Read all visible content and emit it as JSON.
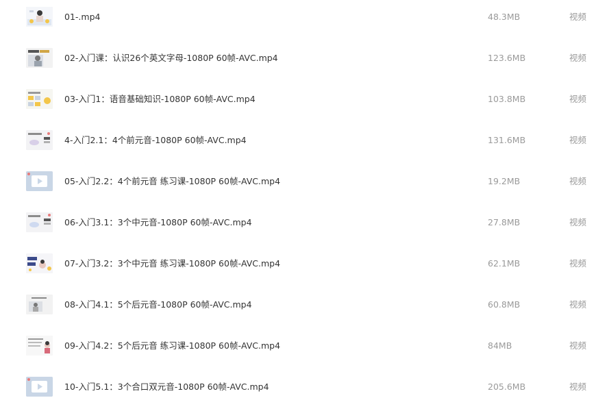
{
  "files": [
    {
      "name": "01-.mp4",
      "size": "48.3MB",
      "type": "视频",
      "thumb_icon": "video-thumbnail-icon"
    },
    {
      "name": "02-入门课：认识26个英文字母-1080P 60帧-AVC.mp4",
      "size": "123.6MB",
      "type": "视频",
      "thumb_icon": "video-thumbnail-icon"
    },
    {
      "name": "03-入门1：语音基础知识-1080P 60帧-AVC.mp4",
      "size": "103.8MB",
      "type": "视频",
      "thumb_icon": "video-thumbnail-icon"
    },
    {
      "name": "4-入门2.1：4个前元音-1080P 60帧-AVC.mp4",
      "size": "131.6MB",
      "type": "视频",
      "thumb_icon": "video-thumbnail-icon"
    },
    {
      "name": "05-入门2.2：4个前元音 练习课-1080P 60帧-AVC.mp4",
      "size": "19.2MB",
      "type": "视频",
      "thumb_icon": "video-play-placeholder-icon"
    },
    {
      "name": "06-入门3.1：3个中元音-1080P 60帧-AVC.mp4",
      "size": "27.8MB",
      "type": "视频",
      "thumb_icon": "video-thumbnail-icon"
    },
    {
      "name": "07-入门3.2：3个中元音 练习课-1080P 60帧-AVC.mp4",
      "size": "62.1MB",
      "type": "视频",
      "thumb_icon": "video-thumbnail-icon"
    },
    {
      "name": "08-入门4.1：5个后元音-1080P 60帧-AVC.mp4",
      "size": "60.8MB",
      "type": "视频",
      "thumb_icon": "video-thumbnail-icon"
    },
    {
      "name": "09-入门4.2：5个后元音 练习课-1080P 60帧-AVC.mp4",
      "size": "84MB",
      "type": "视频",
      "thumb_icon": "video-thumbnail-icon"
    },
    {
      "name": "10-入门5.1：3个合口双元音-1080P 60帧-AVC.mp4",
      "size": "205.6MB",
      "type": "视频",
      "thumb_icon": "video-play-placeholder-icon"
    }
  ],
  "colors": {
    "name_text": "#333333",
    "meta_text": "#9a9a9a",
    "background": "#ffffff",
    "thumb_accent": "#f3c64a"
  }
}
